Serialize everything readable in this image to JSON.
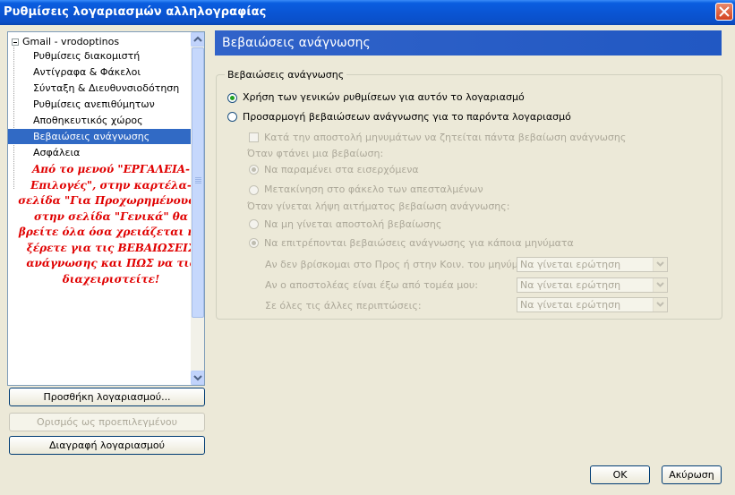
{
  "window": {
    "title": "Ρυθμίσεις λογαριασμών αλληλογραφίας"
  },
  "tree": {
    "account": "Gmail - vrodoptinos",
    "items": [
      {
        "label": "Ρυθμίσεις διακομιστή"
      },
      {
        "label": "Αντίγραφα & Φάκελοι"
      },
      {
        "label": "Σύνταξη & Διευθυνσιοδότηση"
      },
      {
        "label": "Ρυθμίσεις ανεπιθύμητων"
      },
      {
        "label": "Αποθηκευτικός χώρος"
      },
      {
        "label": "Βεβαιώσεις ανάγνωσης"
      },
      {
        "label": "Ασφάλεια"
      }
    ],
    "selected_index": 5
  },
  "annotation": "Από το μενού \"ΕΡΓΑΛΕΙΑ-Επιλογές\", στην καρτέλα-σελίδα \"Για Προχωρημένους\", στην σελίδα \"Γενικά\" θα βρείτε όλα όσα χρειάζεται να ξέρετε για τις ΒΕΒΑΙΩΣΕΙΣ ανάγνωσης και ΠΩΣ να τις διαχειριστείτε!",
  "buttons": {
    "add_account": "Προσθήκη λογαριασμού...",
    "set_default": "Ορισμός ως προεπιλεγμένου",
    "delete_account": "Διαγραφή λογαριασμού",
    "ok": "OK",
    "cancel": "Ακύρωση"
  },
  "panel": {
    "header": "Βεβαιώσεις ανάγνωσης",
    "group_label": "Βεβαιώσεις ανάγνωσης",
    "use_global": "Χρήση των γενικών ρυθμίσεων για αυτόν το λογαριασμό",
    "customize": "Προσαρμογή βεβαιώσεων ανάγνωσης για το παρόντα λογαριασμό",
    "always_request": "Κατά την αποστολή μηνυμάτων να ζητείται πάντα βεβαίωση ανάγνωσης",
    "when_arrives": "Όταν φτάνει μια βεβαίωση:",
    "leave_inbox": "Να παραμένει στα εισερχόμενα",
    "move_sent": "Μετακίνηση στο φάκελο των απεσταλμένων",
    "when_requested": "Όταν γίνεται λήψη αιτήματος βεβαίωση ανάγνωσης:",
    "never_send": "Να μη γίνεται αποστολή βεβαίωσης",
    "allow_some": "Να επιτρέπονται βεβαιώσεις ανάγνωσης για κάποια μηνύματα",
    "rules": [
      {
        "label": "Αν δεν βρίσκομαι στο Προς ή στην Κοιν. του μηνύματος:",
        "value": "Να γίνεται ερώτηση"
      },
      {
        "label": "Αν ο αποστολέας είναι έξω από τομέα μου:",
        "value": "Να γίνεται ερώτηση"
      },
      {
        "label": "Σε όλες τις άλλες περιπτώσεις:",
        "value": "Να γίνεται ερώτηση"
      }
    ],
    "selected_option": "use_global",
    "always_request_checked": false
  },
  "colors": {
    "titlebar": "#0a55d4",
    "selection": "#316ac5",
    "annotation": "#e00000",
    "header": "#2158c3"
  }
}
